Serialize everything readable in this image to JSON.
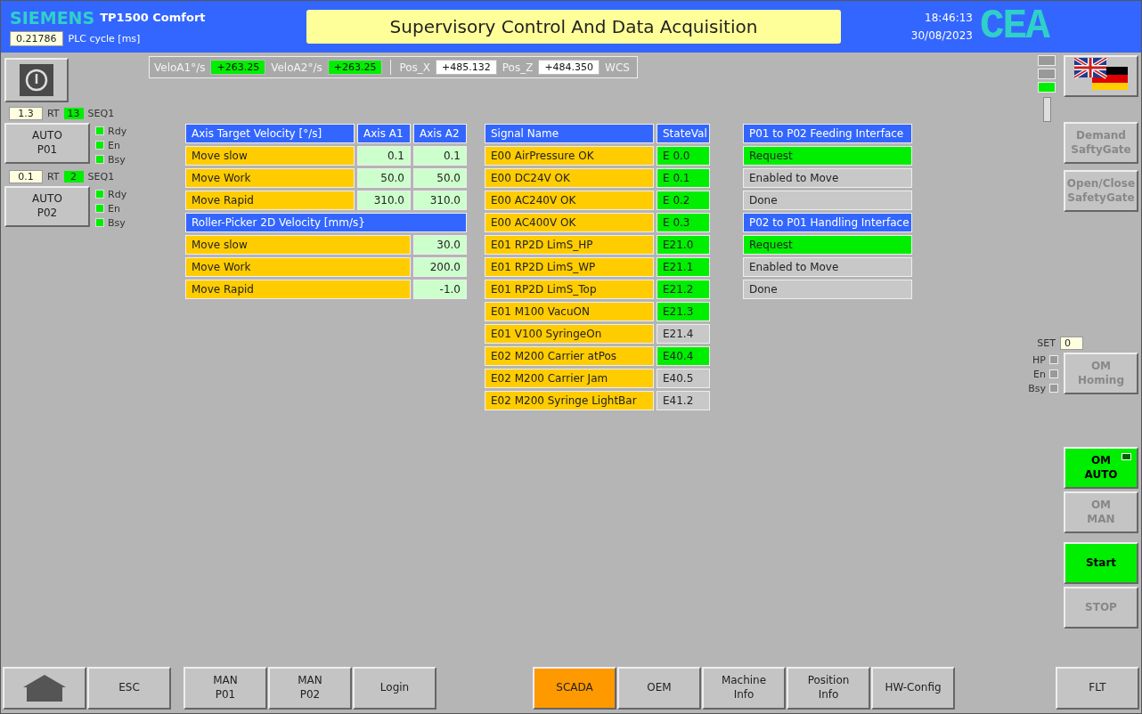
{
  "header": {
    "brand": "SIEMENS",
    "model": "TP1500 Comfort",
    "plc_cycle": {
      "value": "0.21786",
      "label": "PLC cycle [ms]"
    },
    "title": "Supervisory Control And Data Acquisition",
    "time": "18:46:13",
    "date": "30/08/2023",
    "logo": "CEA"
  },
  "readouts": {
    "groups": [
      [
        {
          "label": "VeloA1°/s",
          "value": "+263.25",
          "highlighted": true
        },
        {
          "label": "VeloA2°/s",
          "value": "+263.25",
          "highlighted": true
        }
      ],
      [
        {
          "label": "Pos_X",
          "value": "+485.132",
          "highlighted": false
        },
        {
          "label": "Pos_Z",
          "value": "+484.350",
          "highlighted": false
        }
      ]
    ],
    "frame": "WCS"
  },
  "stations": [
    {
      "cycle": "1.3",
      "rt": "RT",
      "seq_count": "13",
      "seq": "SEQ1",
      "button": [
        "AUTO",
        "P01"
      ],
      "leds": [
        {
          "label": "Rdy",
          "on": true
        },
        {
          "label": "En",
          "on": true
        },
        {
          "label": "Bsy",
          "on": true
        }
      ]
    },
    {
      "cycle": "0.1",
      "rt": "RT",
      "seq_count": "2",
      "seq": "SEQ1",
      "button": [
        "AUTO",
        "P02"
      ],
      "leds": [
        {
          "label": "Rdy",
          "on": true
        },
        {
          "label": "En",
          "on": true
        },
        {
          "label": "Bsy",
          "on": true
        }
      ]
    }
  ],
  "velocity_table": {
    "columns": [
      "Axis Target Velocity [°/s]",
      "Axis A1",
      "Axis A2"
    ],
    "rows": [
      {
        "name": "Move slow",
        "a1": "0.1",
        "a2": "0.1"
      },
      {
        "name": "Move Work",
        "a1": "50.0",
        "a2": "50.0"
      },
      {
        "name": "Move Rapid",
        "a1": "310.0",
        "a2": "310.0"
      }
    ],
    "section": "Roller-Picker 2D Velocity [mm/s}",
    "section_rows": [
      {
        "name": "Move slow",
        "value": "30.0"
      },
      {
        "name": "Move Work",
        "value": "200.0"
      },
      {
        "name": "Move Rapid",
        "value": "-1.0"
      }
    ]
  },
  "signal_table": {
    "columns": [
      "Signal Name",
      "StateVal"
    ],
    "rows": [
      {
        "name": "E00 AirPressure OK",
        "value": "E 0.0",
        "on": true
      },
      {
        "name": "E00 DC24V OK",
        "value": "E 0.1",
        "on": true
      },
      {
        "name": "E00 AC240V OK",
        "value": "E 0.2",
        "on": true
      },
      {
        "name": "E00 AC400V OK",
        "value": "E 0.3",
        "on": true
      },
      {
        "name": "E01 RP2D LimS_HP",
        "value": "E21.0",
        "on": true
      },
      {
        "name": "E01 RP2D LimS_WP",
        "value": "E21.1",
        "on": true
      },
      {
        "name": "E01 RP2D LimS_Top",
        "value": "E21.2",
        "on": true
      },
      {
        "name": "E01 M100 VacuON",
        "value": "E21.3",
        "on": true
      },
      {
        "name": "E01 V100 SyringeOn",
        "value": "E21.4",
        "on": false
      },
      {
        "name": "E02 M200 Carrier atPos",
        "value": "E40.4",
        "on": true
      },
      {
        "name": "E02 M200 Carrier Jam",
        "value": "E40.5",
        "on": false
      },
      {
        "name": "E02 M200 Syringe LightBar",
        "value": "E41.2",
        "on": false
      }
    ]
  },
  "interfaces": [
    {
      "title": "P01 to P02 Feeding Interface",
      "items": [
        {
          "label": "Request",
          "on": true
        },
        {
          "label": "Enabled to Move",
          "on": false
        },
        {
          "label": "Done",
          "on": false
        }
      ]
    },
    {
      "title": "P02 to P01 Handling Interface",
      "items": [
        {
          "label": "Request",
          "on": true
        },
        {
          "label": "Enabled to Move",
          "on": false
        },
        {
          "label": "Done",
          "on": false
        }
      ]
    }
  ],
  "indicators": [
    {
      "on": false
    },
    {
      "on": false
    },
    {
      "on": true
    }
  ],
  "gate_buttons": [
    {
      "label": [
        "Demand",
        "SaftyGate"
      ],
      "disabled": true
    },
    {
      "label": [
        "Open/Close",
        "SafetyGate"
      ],
      "disabled": true
    }
  ],
  "homing": {
    "set_label": "SET",
    "set_value": "0",
    "leds": [
      {
        "label": "HP",
        "on": false
      },
      {
        "label": "En",
        "on": false
      },
      {
        "label": "Bsy",
        "on": false
      }
    ],
    "button": {
      "label": [
        "OM",
        "Homing"
      ],
      "disabled": true
    }
  },
  "mode_buttons": [
    {
      "label": [
        "OM",
        "AUTO"
      ],
      "active": true,
      "disabled": false
    },
    {
      "label": [
        "OM",
        "MAN"
      ],
      "active": false,
      "disabled": true
    }
  ],
  "run_buttons": [
    {
      "label": [
        "Start"
      ],
      "active": true,
      "disabled": false
    },
    {
      "label": [
        "STOP"
      ],
      "active": false,
      "disabled": true
    }
  ],
  "nav_groups": [
    [
      {
        "kind": "home",
        "selected": false
      },
      {
        "kind": "text",
        "label": [
          "ESC"
        ],
        "selected": false
      }
    ],
    [
      {
        "kind": "text",
        "label": [
          "MAN",
          "P01"
        ],
        "selected": false
      },
      {
        "kind": "text",
        "label": [
          "MAN",
          "P02"
        ],
        "selected": false
      },
      {
        "kind": "text",
        "label": [
          "Login"
        ],
        "selected": false
      }
    ],
    [
      {
        "kind": "text",
        "label": [
          "SCADA"
        ],
        "selected": true
      },
      {
        "kind": "text",
        "label": [
          "OEM"
        ],
        "selected": false
      },
      {
        "kind": "text",
        "label": [
          "Machine",
          "Info"
        ],
        "selected": false
      },
      {
        "kind": "text",
        "label": [
          "Position",
          "Info"
        ],
        "selected": false
      },
      {
        "kind": "text",
        "label": [
          "HW-Config"
        ],
        "selected": false
      }
    ],
    [
      {
        "kind": "text",
        "label": [
          "FLT"
        ],
        "selected": false
      }
    ]
  ]
}
